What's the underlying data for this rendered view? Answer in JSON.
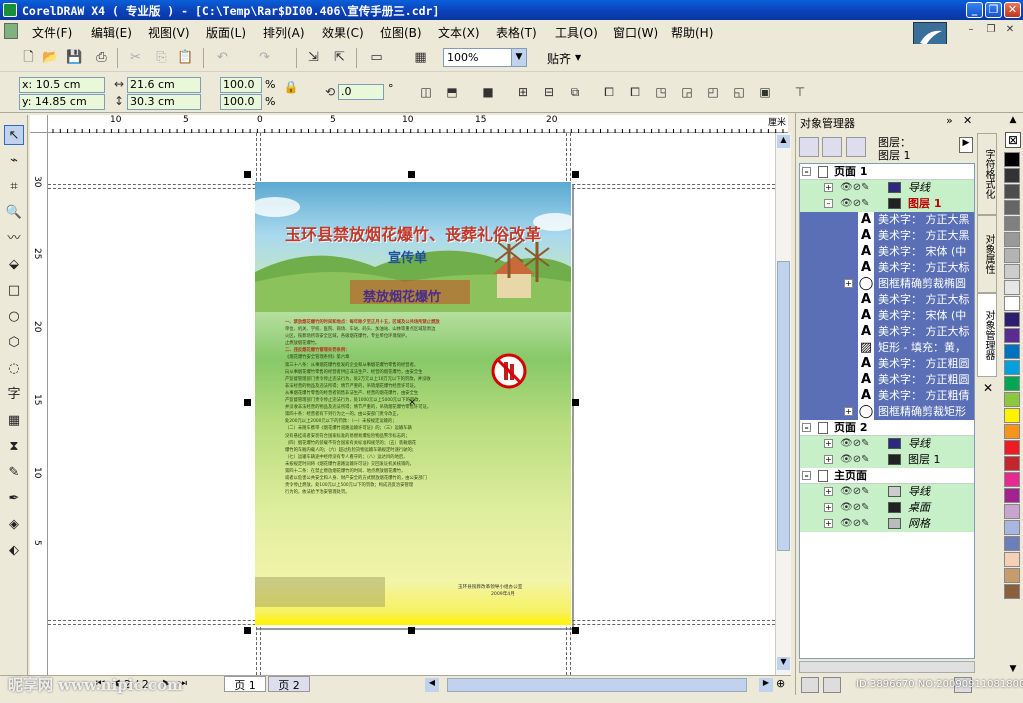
{
  "title": {
    "text": "CorelDRAW X4 ( 专业版 ) - [C:\\Temp\\Rar$DI00.406\\宣传手册三.cdr]",
    "min": "_",
    "max": "❐",
    "close": "✕"
  },
  "menu": [
    "文件(F)",
    "编辑(E)",
    "视图(V)",
    "版面(L)",
    "排列(A)",
    "效果(C)",
    "位图(B)",
    "文本(X)",
    "表格(T)",
    "工具(O)",
    "窗口(W)",
    "帮助(H)"
  ],
  "toolbar": {
    "zoom": "100%",
    "snap": "贴齐"
  },
  "props": {
    "x": "x: 10.5 cm",
    "y": "y: 14.85 cm",
    "w": "21.6 cm",
    "h": "30.3 cm",
    "sx": "100.0",
    "sy": "100.0",
    "pct": "%",
    "rot": ".0",
    "deg": "°"
  },
  "ruler": {
    "top": [
      "10",
      "5",
      "0",
      "5",
      "10",
      "15",
      "20",
      "厘米"
    ],
    "left": [
      "30",
      "25",
      "20",
      "15",
      "10",
      "5"
    ]
  },
  "poster": {
    "title": "玉环县禁放烟花爆竹、丧葬礼俗改革",
    "subtitle": "宣传单",
    "banner": "禁放烟花爆竹",
    "lines": [
      "一、禁放烟花爆竹的时间和地点：每年除夕至正月十五，区域及公共场所禁止燃放",
      "单位、机关、学校、医院、商场、车站、码头、加油站、山林等重点区域及周边",
      "火区，殡葬场所等安全区域，各级烟花爆竹，专业单位环境保护。",
      "止燃放烟花爆竹。",
      "",
      "二、违反烟花爆竹管理处罚条例：",
      "《烟花爆竹安全管理条例》第六章",
      "第三十八条：从事烟花爆竹批发的企业和从事烟花爆竹零售的经营者，",
      "向从事烟花爆竹零售的经营者供应非法生产、经营的烟花爆竹，由安全生",
      "产监督管理部门责令停止违法行为，处2万元以上10万元以下的罚款，并没收",
      "非法经营的物品及违法所得；情节严重的，吊销烟花爆竹经营许可证。",
      "从事烟花爆竹零售的经营者销售非法生产、经营的烟花爆竹，由安全生",
      "产监督管理部门责令停止违法行为，处1000元以上5000元以下的罚款，",
      "并没收非法经营的物品及违法所得；情节严重的，吊销烟花爆竹零售许可证。",
      "第四十条：经营者有下列行为之一的，由公安部门责令改正，",
      "处200元以上2000元以下的罚款：（一）未按规定运输的；",
      "（二）未随车携带《烟花爆竹道路运输许可证》的；（三）运输车辆",
      "没有悬挂或者安装符合国家标准的易燃易爆危险物品警示标志的；",
      "（四）烟花爆竹的装载不符合国家有关标准和规范的；（五）装载烟花",
      "爆竹的车厢内载人的；（六）超过危险货物运输车辆规定时速行驶的；",
      "（七）运输车辆途中经停没有专人看守的；（八）运达目的地后，",
      "未按规定时间将《烟花爆竹道路运输许可证》交回发证机关核销的。",
      "",
      "第四十二条：在禁止燃放烟花爆竹的时间、地点燃放烟花爆竹，",
      "或者以危害公共安全和人身、财产安全的方式燃放烟花爆竹的，由公安部门",
      "责令停止燃放，处100元以上500元以下的罚款；构成违反治安管理",
      "行为的，依法给予治安管理处罚。"
    ],
    "footer1": "玉环县殡葬改革领导小组办公室",
    "footer2": "2009年4月"
  },
  "docker": {
    "title": "对象管理器",
    "layer_label1": "图层：",
    "layer_label2": "图层 1",
    "rows": [
      {
        "label": "页面 1",
        "kind": "page"
      },
      {
        "label": "导线",
        "kind": "layer",
        "color": "#2a2a7a"
      },
      {
        "label": "图层 1",
        "kind": "layer-active",
        "color": "#222222"
      },
      {
        "label": "美术字： 方正大黑",
        "kind": "obj-sel"
      },
      {
        "label": "美术字： 方正大黑",
        "kind": "obj-sel"
      },
      {
        "label": "美术字： 宋体 (中",
        "kind": "obj-sel"
      },
      {
        "label": "美术字： 方正大标",
        "kind": "obj-sel"
      },
      {
        "label": "图框精确剪裁椭圆",
        "kind": "obj-sel"
      },
      {
        "label": "美术字： 方正大标",
        "kind": "obj-sel"
      },
      {
        "label": "美术字： 宋体 (中",
        "kind": "obj-sel"
      },
      {
        "label": "美术字： 方正大标",
        "kind": "obj-sel"
      },
      {
        "label": "矩形 - 填充：黄，",
        "kind": "obj-sel"
      },
      {
        "label": "美术字： 方正粗圆",
        "kind": "obj-sel"
      },
      {
        "label": "美术字： 方正粗圆",
        "kind": "obj-sel"
      },
      {
        "label": "美术字： 方正粗倩",
        "kind": "obj-sel"
      },
      {
        "label": "图框精确剪裁矩形",
        "kind": "obj-sel"
      },
      {
        "label": "页面 2",
        "kind": "page"
      },
      {
        "label": "导线",
        "kind": "layer",
        "color": "#2a2a7a"
      },
      {
        "label": "图层 1",
        "kind": "layer",
        "color": "#222222"
      },
      {
        "label": "主页面",
        "kind": "page"
      },
      {
        "label": "导线",
        "kind": "layer",
        "color": "#cccccc"
      },
      {
        "label": "桌面",
        "kind": "layer",
        "color": "#222222"
      },
      {
        "label": "网格",
        "kind": "layer",
        "color": "#bbbbbb"
      }
    ]
  },
  "vtabs": [
    "字符格式化",
    "对象属性",
    "对象管理器"
  ],
  "pages": {
    "counter": "2 / 2",
    "tab1": "页 1",
    "tab2": "页 2"
  },
  "watermark": "昵享网 www.nipic.com",
  "id_text": "ID:3896670 NO:20090911081800004213",
  "palette": [
    "#000000",
    "#333333",
    "#4d4d4d",
    "#666666",
    "#808080",
    "#999999",
    "#b3b3b3",
    "#cccccc",
    "#e6e6e6",
    "#ffffff",
    "#2e1f6e",
    "#5b2c8f",
    "#0070c0",
    "#00a0e0",
    "#00a651",
    "#8dc63f",
    "#fff200",
    "#f7941d",
    "#ed1c24",
    "#c4262e",
    "#e52b8f",
    "#a3238e",
    "#c7a5cf",
    "#a9b6e0",
    "#6c7fb9",
    "#f5d0b9",
    "#c69c6d",
    "#8b5e3c"
  ]
}
